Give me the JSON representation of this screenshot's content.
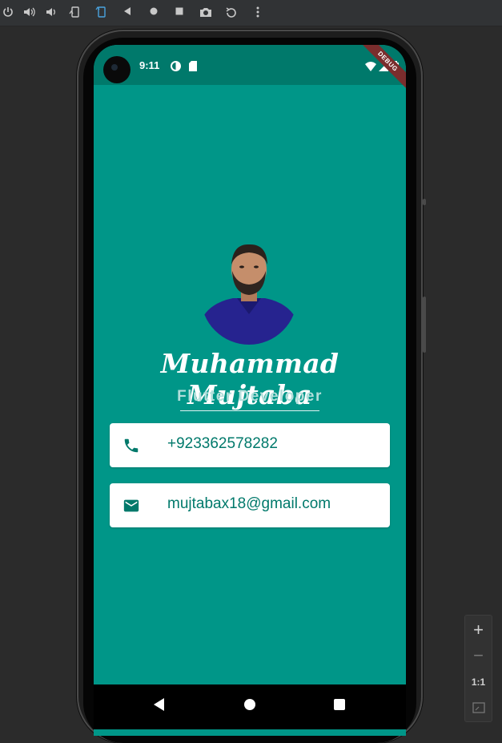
{
  "emulator": {
    "toolbar_icons": [
      "power-icon",
      "volume-up-icon",
      "volume-down-icon",
      "rotate-left-icon",
      "rotate-right-icon",
      "back-icon",
      "home-icon",
      "overview-icon",
      "camera-icon",
      "replay-icon",
      "more-icon"
    ],
    "zoom": {
      "plus_label": "+",
      "minus_label": "−",
      "one_to_one_label": "1:1"
    }
  },
  "status_bar": {
    "time": "9:11",
    "debug_label": "DEBUG"
  },
  "profile": {
    "name": "Muhammad Mujtaba",
    "title": "Flutter Developer"
  },
  "contacts": [
    {
      "type": "phone",
      "icon": "phone-icon",
      "value": "+923362578282"
    },
    {
      "type": "email",
      "icon": "mail-icon",
      "value": "mujtabax18@gmail.com"
    }
  ],
  "colors": {
    "primary": "#009688",
    "status_bar": "#00796b",
    "card_text": "#00796b",
    "subtitle": "#b2dfdb"
  }
}
